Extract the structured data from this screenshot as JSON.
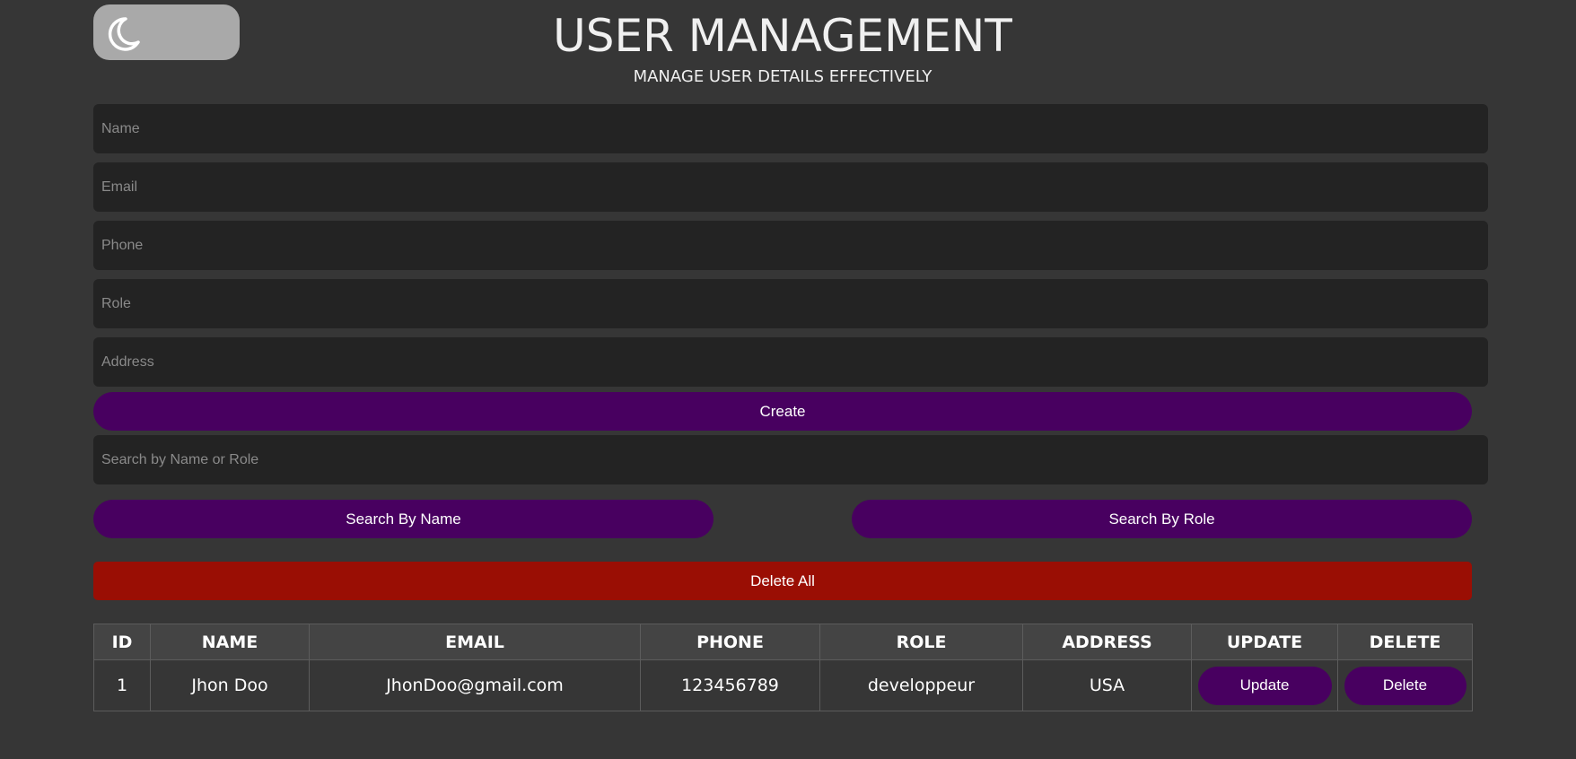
{
  "header": {
    "title": "USER MANAGEMENT",
    "subtitle": "MANAGE USER DETAILS EFFECTIVELY"
  },
  "theme_toggle": {
    "icon": "moon-icon"
  },
  "form": {
    "name_placeholder": "Name",
    "email_placeholder": "Email",
    "phone_placeholder": "Phone",
    "role_placeholder": "Role",
    "address_placeholder": "Address",
    "create_label": "Create"
  },
  "search": {
    "placeholder": "Search by Name or Role",
    "by_name_label": "Search By Name",
    "by_role_label": "Search By Role"
  },
  "delete_all_label": "Delete All",
  "table": {
    "columns": [
      "ID",
      "NAME",
      "EMAIL",
      "PHONE",
      "ROLE",
      "ADDRESS",
      "UPDATE",
      "DELETE"
    ],
    "rows": [
      {
        "id": "1",
        "name": "Jhon Doo",
        "email": "JhonDoo@gmail.com",
        "phone": "123456789",
        "role": "developpeur",
        "address": "USA",
        "update_label": "Update",
        "delete_label": "Delete"
      }
    ]
  },
  "colors": {
    "background": "#363636",
    "input_bg": "#232323",
    "primary_button": "#480060",
    "danger_button": "#9a0e04",
    "toggle_bg": "#a9a9a9"
  }
}
